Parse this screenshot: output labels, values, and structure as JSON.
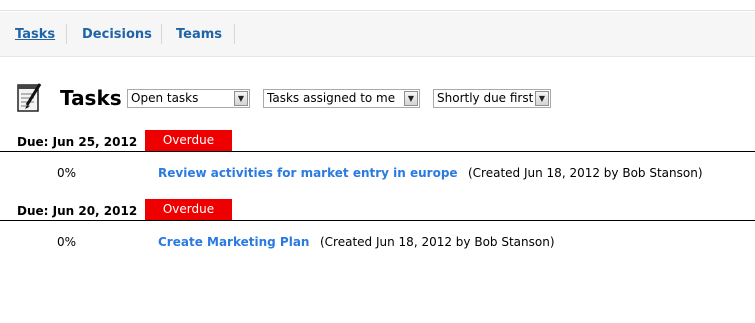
{
  "nav": {
    "tabs": [
      {
        "label": "Tasks",
        "active": true
      },
      {
        "label": "Decisions",
        "active": false
      },
      {
        "label": "Teams",
        "active": false
      }
    ]
  },
  "header": {
    "title": "Tasks",
    "icon": "notepad-pencil-icon"
  },
  "filters": {
    "status": "Open tasks",
    "assignment": "Tasks assigned to me",
    "sort": "Shortly due first"
  },
  "groups": [
    {
      "due_label": "Due: Jun 25, 2012",
      "badge": "Overdue",
      "tasks": [
        {
          "progress": "0%",
          "title": "Review activities for market entry in europe",
          "meta": "(Created Jun 18, 2012 by Bob Stanson)"
        }
      ]
    },
    {
      "due_label": "Due: Jun 20, 2012",
      "badge": "Overdue",
      "tasks": [
        {
          "progress": "0%",
          "title": "Create Marketing Plan",
          "meta": "(Created Jun 18, 2012 by Bob Stanson)"
        }
      ]
    }
  ],
  "colors": {
    "nav_link": "#1f63a8",
    "task_link": "#2a7ae2",
    "overdue_badge": "#ee0000"
  }
}
